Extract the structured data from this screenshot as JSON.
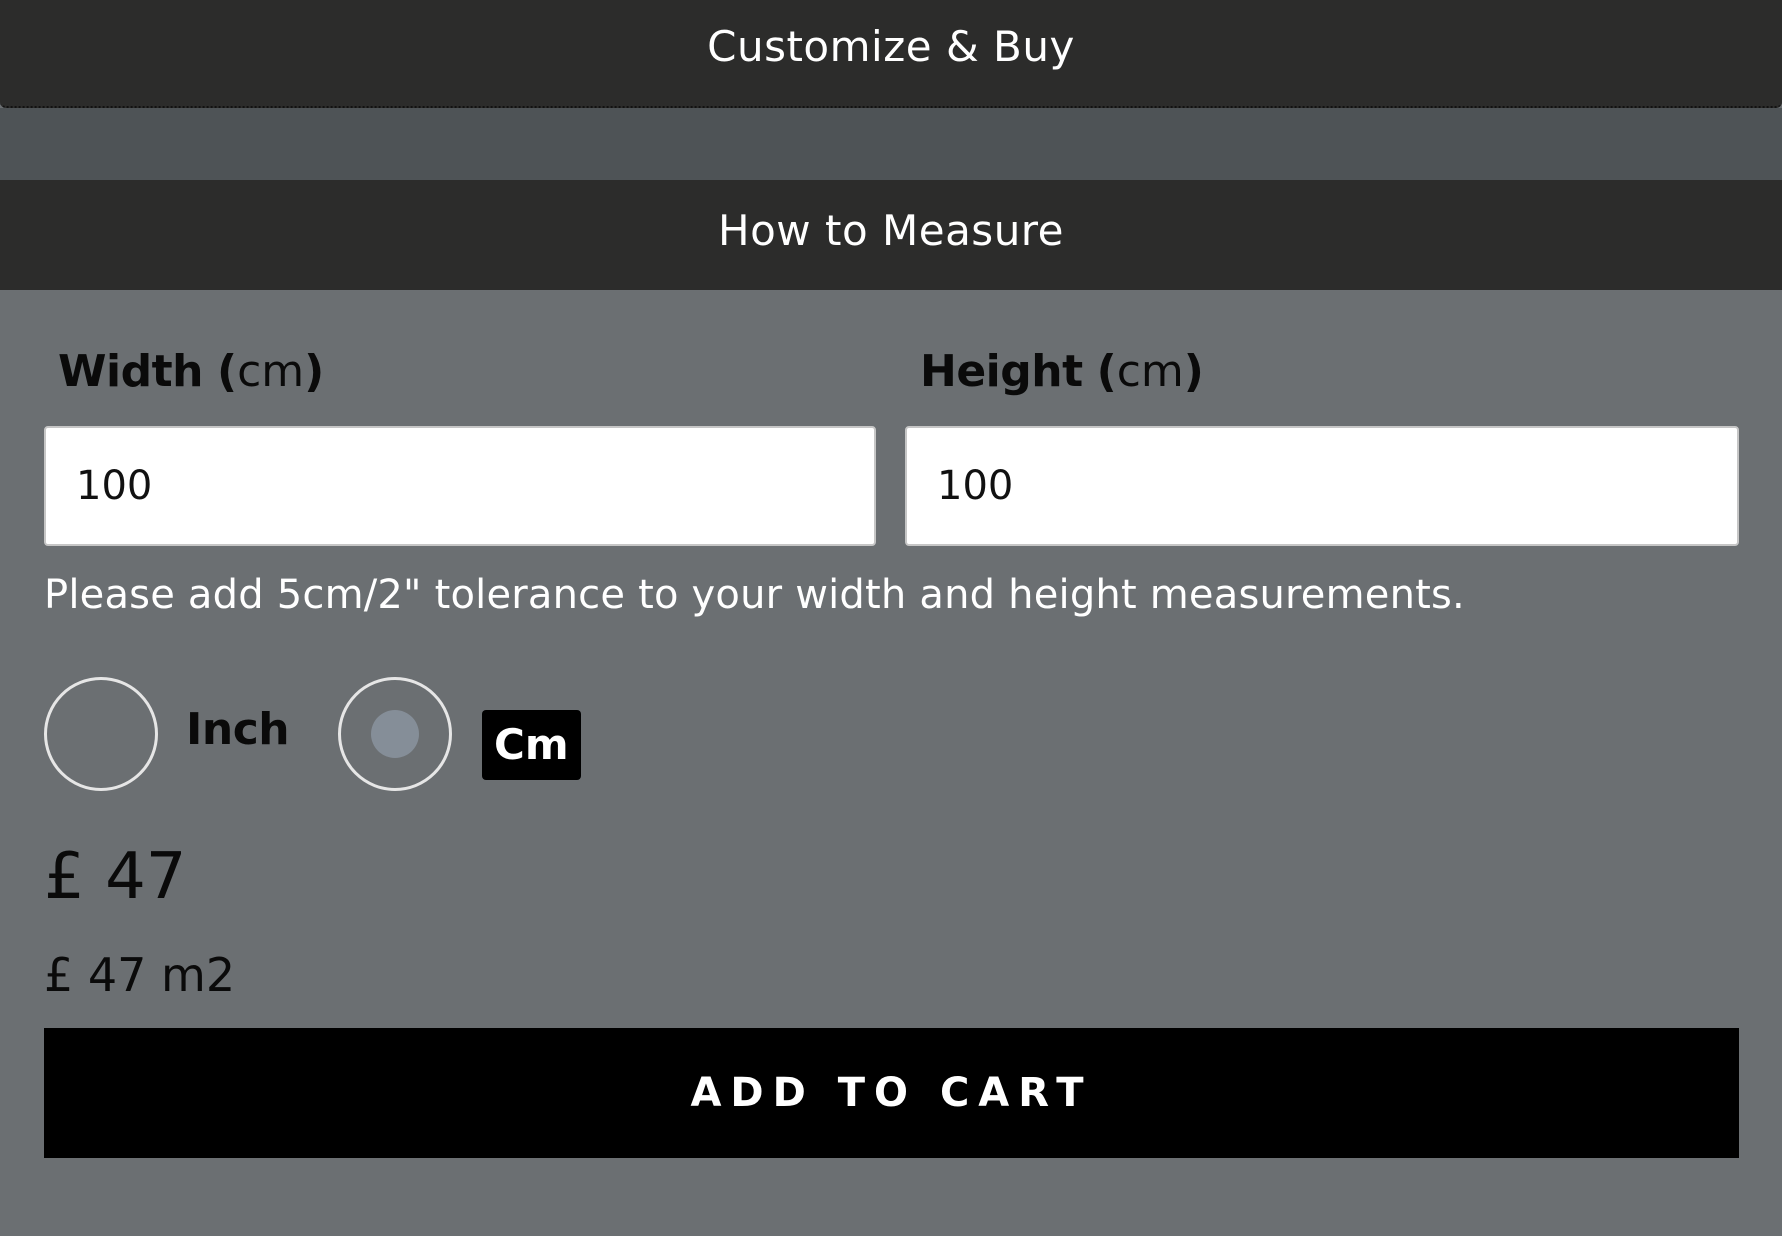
{
  "sections": {
    "customize_title": "Customize & Buy",
    "measure_title": "How to Measure"
  },
  "width_field": {
    "label": "Width",
    "unit": "cm",
    "value": "100"
  },
  "height_field": {
    "label": "Height",
    "unit": "cm",
    "value": "100"
  },
  "tolerance_note": "Please add 5cm/2\" tolerance to your width and height measurements.",
  "units": {
    "options": [
      {
        "label": "Inch",
        "selected": false
      },
      {
        "label": "Cm",
        "selected": true
      }
    ]
  },
  "price": {
    "total": "£ 47",
    "per_m2": "£ 47 m2"
  },
  "cart": {
    "button_label": "ADD TO CART"
  },
  "colors": {
    "panel_bg": "#6b6f72",
    "header_bar": "#2c2c2b",
    "band": "#4e5356",
    "button": "#000000",
    "radio_dot": "#858e98"
  },
  "icons": {
    "unit_radio": "radio-circle-icon"
  }
}
